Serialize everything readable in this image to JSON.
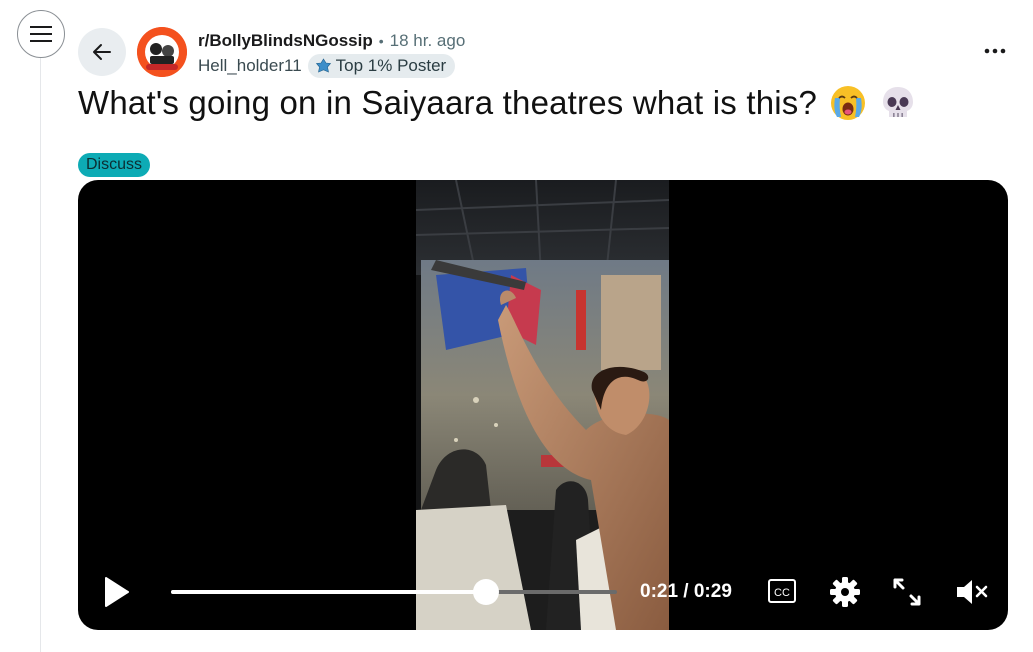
{
  "post": {
    "subreddit": "r/BollyBlindsNGossip",
    "separator": "•",
    "time": "18 hr. ago",
    "author": "Hell_holder11",
    "author_flair": "Top 1% Poster",
    "title": "What's going on in Saiyaara theatres what is this?",
    "title_emojis": [
      "crying-face",
      "skull"
    ],
    "post_flair": "Discuss"
  },
  "video": {
    "current_time": "0:21",
    "duration": "0:29",
    "time_readout": "0:21 / 0:29",
    "progress": 0.707,
    "muted": true,
    "cc_label": "CC"
  },
  "icons": {
    "menu": "hamburger-icon",
    "back": "arrow-left-icon",
    "more": "ellipsis-icon",
    "play": "play-icon",
    "settings": "gear-icon",
    "fullscreen": "expand-icon",
    "mute": "speaker-muted-icon"
  },
  "colors": {
    "flair_teal": "#0dabb5",
    "subreddit_orange": "#f4511e",
    "chip_bg": "#e5ebee"
  }
}
